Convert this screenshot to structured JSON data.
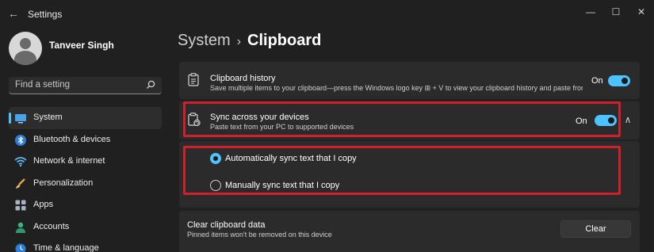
{
  "window": {
    "title": "Settings",
    "back_glyph": "←",
    "minimize_glyph": "—",
    "maximize_glyph": "☐",
    "close_glyph": "✕"
  },
  "user": {
    "name": "Tanveer Singh"
  },
  "search": {
    "placeholder": "Find a setting"
  },
  "nav": {
    "items": [
      {
        "label": "System",
        "icon": "monitor-icon",
        "active": true
      },
      {
        "label": "Bluetooth & devices",
        "icon": "bluetooth-icon"
      },
      {
        "label": "Network & internet",
        "icon": "wifi-icon"
      },
      {
        "label": "Personalization",
        "icon": "brush-icon"
      },
      {
        "label": "Apps",
        "icon": "apps-icon"
      },
      {
        "label": "Accounts",
        "icon": "person-icon"
      },
      {
        "label": "Time & language",
        "icon": "globe-clock-icon"
      }
    ]
  },
  "breadcrumb": {
    "parent": "System",
    "separator": "›",
    "current": "Clipboard"
  },
  "clipboard_history": {
    "title": "Clipboard history",
    "description": "Save multiple items to your clipboard—press the Windows logo key ⊞ + V to view your clipboard history and paste from it",
    "state_label": "On",
    "on": true
  },
  "sync": {
    "title": "Sync across your devices",
    "description": "Paste text from your PC to supported devices",
    "state_label": "On",
    "on": true,
    "chevron_glyph": "∧",
    "options": [
      {
        "label": "Automatically sync text that I copy",
        "selected": true
      },
      {
        "label": "Manually sync text that I copy",
        "selected": false
      }
    ]
  },
  "clear_data": {
    "title": "Clear clipboard data",
    "description": "Pinned items won't be removed on this device",
    "button_label": "Clear"
  },
  "colors": {
    "accent": "#4cc2ff",
    "highlight": "#d0202a",
    "background": "#202020",
    "card": "#2b2b2b"
  }
}
